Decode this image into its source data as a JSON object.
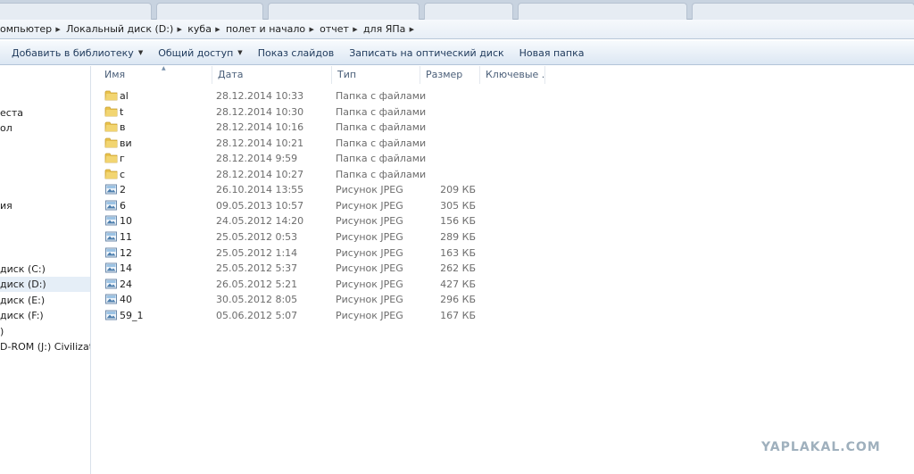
{
  "breadcrumb": [
    "омпьютер",
    "Локальный диск (D:)",
    "куба",
    "полет и начало",
    "отчет",
    "для ЯПа"
  ],
  "toolbar": {
    "add_to_library": "Добавить в библиотеку",
    "share": "Общий доступ",
    "slideshow": "Показ слайдов",
    "burn": "Записать на оптический диск",
    "new_folder": "Новая папка"
  },
  "nav": {
    "items": [
      "еста",
      "ол",
      "ия",
      "диск (C:)",
      "диск (D:)",
      "диск (E:)",
      "диск (F:)",
      ")",
      "D-ROM (J:) CivilizationV"
    ],
    "selected": "диск (D:)"
  },
  "columns": {
    "name": "Имя",
    "date": "Дата",
    "type": "Тип",
    "size": "Размер",
    "tags": "Ключевые ..."
  },
  "files": [
    {
      "icon": "folder-icon",
      "name": "al",
      "date": "28.12.2014 10:33",
      "type": "Папка с файлами",
      "size": ""
    },
    {
      "icon": "folder-icon",
      "name": "t",
      "date": "28.12.2014 10:30",
      "type": "Папка с файлами",
      "size": ""
    },
    {
      "icon": "folder-icon",
      "name": "в",
      "date": "28.12.2014 10:16",
      "type": "Папка с файлами",
      "size": ""
    },
    {
      "icon": "folder-icon",
      "name": "ви",
      "date": "28.12.2014 10:21",
      "type": "Папка с файлами",
      "size": ""
    },
    {
      "icon": "folder-icon",
      "name": "г",
      "date": "28.12.2014 9:59",
      "type": "Папка с файлами",
      "size": ""
    },
    {
      "icon": "folder-icon",
      "name": "с",
      "date": "28.12.2014 10:27",
      "type": "Папка с файлами",
      "size": ""
    },
    {
      "icon": "jpeg-icon",
      "name": "2",
      "date": "26.10.2014 13:55",
      "type": "Рисунок JPEG",
      "size": "209 КБ"
    },
    {
      "icon": "jpeg-icon",
      "name": "6",
      "date": "09.05.2013 10:57",
      "type": "Рисунок JPEG",
      "size": "305 КБ"
    },
    {
      "icon": "jpeg-icon",
      "name": "10",
      "date": "24.05.2012 14:20",
      "type": "Рисунок JPEG",
      "size": "156 КБ"
    },
    {
      "icon": "jpeg-icon",
      "name": "11",
      "date": "25.05.2012 0:53",
      "type": "Рисунок JPEG",
      "size": "289 КБ"
    },
    {
      "icon": "jpeg-icon",
      "name": "12",
      "date": "25.05.2012 1:14",
      "type": "Рисунок JPEG",
      "size": "163 КБ"
    },
    {
      "icon": "jpeg-icon",
      "name": "14",
      "date": "25.05.2012 5:37",
      "type": "Рисунок JPEG",
      "size": "262 КБ"
    },
    {
      "icon": "jpeg-icon",
      "name": "24",
      "date": "26.05.2012 5:21",
      "type": "Рисунок JPEG",
      "size": "427 КБ"
    },
    {
      "icon": "jpeg-icon",
      "name": "40",
      "date": "30.05.2012 8:05",
      "type": "Рисунок JPEG",
      "size": "296 КБ"
    },
    {
      "icon": "jpeg-icon",
      "name": "59_1",
      "date": "05.06.2012 5:07",
      "type": "Рисунок JPEG",
      "size": "167 КБ"
    }
  ],
  "watermark": "YAPLAKAL.COM",
  "colors": {
    "folder": "#e9c24c",
    "toolbar_text": "#1e395b",
    "header_text": "#4c607a",
    "selection": "#e5eef7"
  }
}
